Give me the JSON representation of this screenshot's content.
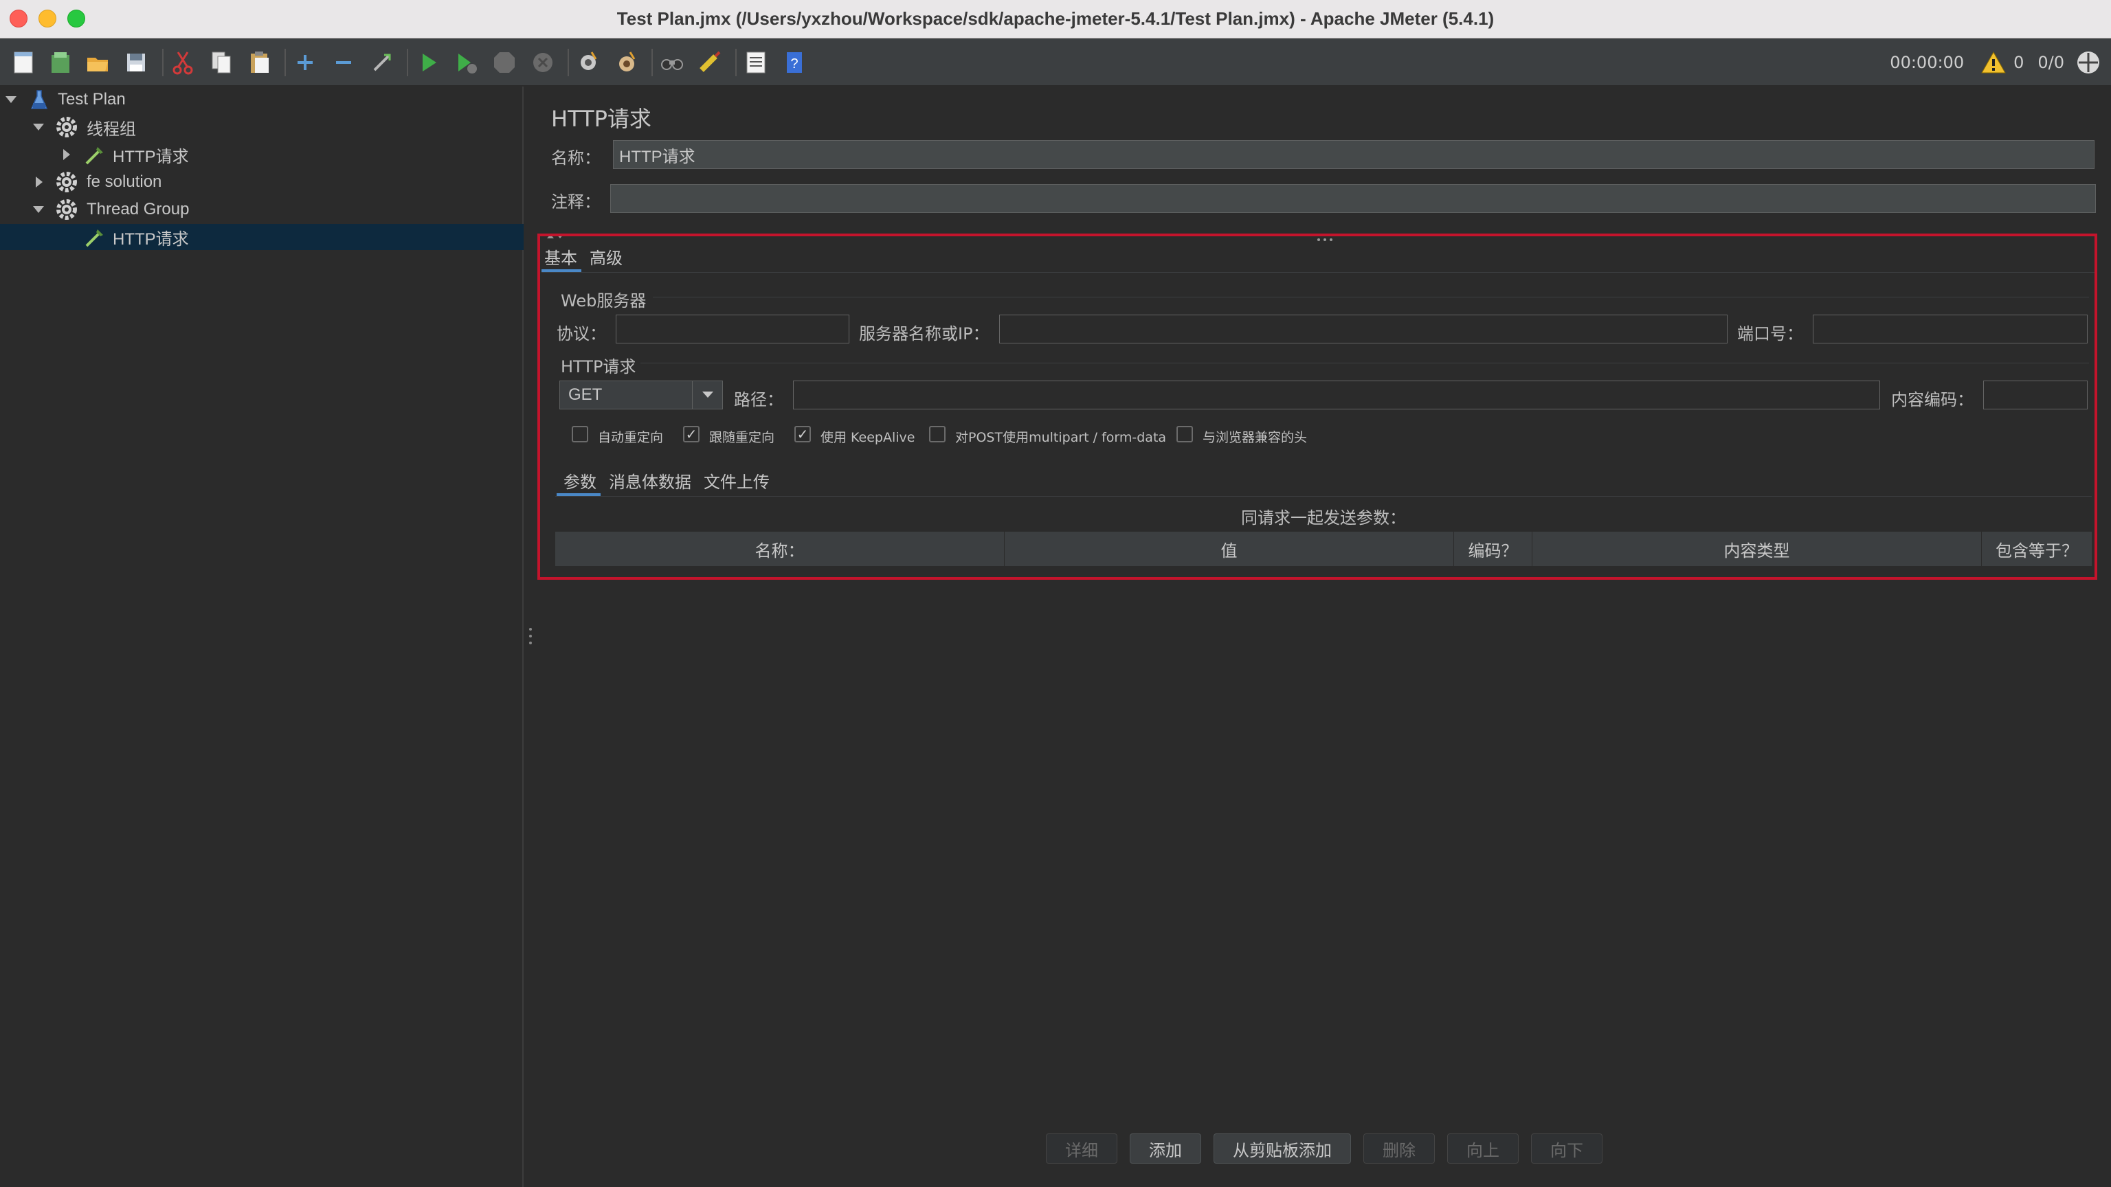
{
  "window": {
    "title": "Test Plan.jmx (/Users/yxzhou/Workspace/sdk/apache-jmeter-5.4.1/Test Plan.jmx) - Apache JMeter (5.4.1)"
  },
  "toolbar": {
    "icons": [
      "new-icon",
      "templates-icon",
      "open-icon",
      "save-icon",
      "cut-icon",
      "copy-icon",
      "paste-icon",
      "expand-icon",
      "collapse-icon",
      "toggle-icon",
      "start-icon",
      "start-no-pause-icon",
      "stop-icon",
      "shutdown-icon",
      "clear-icon",
      "clear-all-icon",
      "search-icon",
      "reset-search-icon",
      "function-helper-icon",
      "help-icon"
    ],
    "timer": "00:00:00",
    "warning_count": "0",
    "thread_ratio": "0/0"
  },
  "tree": {
    "nodes": [
      {
        "label": "Test Plan",
        "level": 0,
        "expanded": true,
        "icon": "test-plan-icon"
      },
      {
        "label": "线程组",
        "level": 1,
        "expanded": true,
        "icon": "gear-icon"
      },
      {
        "label": "HTTP请求",
        "level": 2,
        "expanded": false,
        "icon": "pipette-icon"
      },
      {
        "label": "fe solution",
        "level": 1,
        "expanded": false,
        "icon": "gear-icon"
      },
      {
        "label": "Thread Group",
        "level": 1,
        "expanded": true,
        "icon": "gear-icon"
      },
      {
        "label": "HTTP请求",
        "level": 2,
        "expanded": null,
        "icon": "pipette-icon",
        "selected": true
      }
    ]
  },
  "panel": {
    "title": "HTTP请求",
    "name_label": "名称：",
    "name_value": "HTTP请求",
    "comment_label": "注释：",
    "comment_value": "",
    "tabs": [
      {
        "label": "基本",
        "active": true
      },
      {
        "label": "高级",
        "active": false
      }
    ],
    "web_server": {
      "section_label": "Web服务器",
      "protocol_label": "协议：",
      "protocol_value": "",
      "server_label": "服务器名称或IP：",
      "server_value": "",
      "port_label": "端口号：",
      "port_value": ""
    },
    "http_request": {
      "section_label": "HTTP请求",
      "method": "GET",
      "path_label": "路径：",
      "path_value": "",
      "encoding_label": "内容编码：",
      "encoding_value": ""
    },
    "options": [
      {
        "label": "自动重定向",
        "checked": false
      },
      {
        "label": "跟随重定向",
        "checked": true
      },
      {
        "label": "使用 KeepAlive",
        "checked": true
      },
      {
        "label": "对POST使用multipart / form-data",
        "checked": false
      },
      {
        "label": "与浏览器兼容的头",
        "checked": false
      }
    ],
    "sub_tabs": [
      {
        "label": "参数",
        "active": true
      },
      {
        "label": "消息体数据",
        "active": false
      },
      {
        "label": "文件上传",
        "active": false
      }
    ],
    "params_caption": "同请求一起发送参数：",
    "table_columns": [
      "名称：",
      "值",
      "编码？",
      "内容类型",
      "包含等于？"
    ],
    "buttons": [
      {
        "label": "详细",
        "enabled": false
      },
      {
        "label": "添加",
        "enabled": true
      },
      {
        "label": "从剪贴板添加",
        "enabled": true
      },
      {
        "label": "删除",
        "enabled": false
      },
      {
        "label": "向上",
        "enabled": false
      },
      {
        "label": "向下",
        "enabled": false
      }
    ]
  },
  "colors": {
    "background": "#2b2b2b",
    "selection": "#0d293e",
    "highlight_box": "#c4142c",
    "tab_accent": "#4a88c7"
  }
}
